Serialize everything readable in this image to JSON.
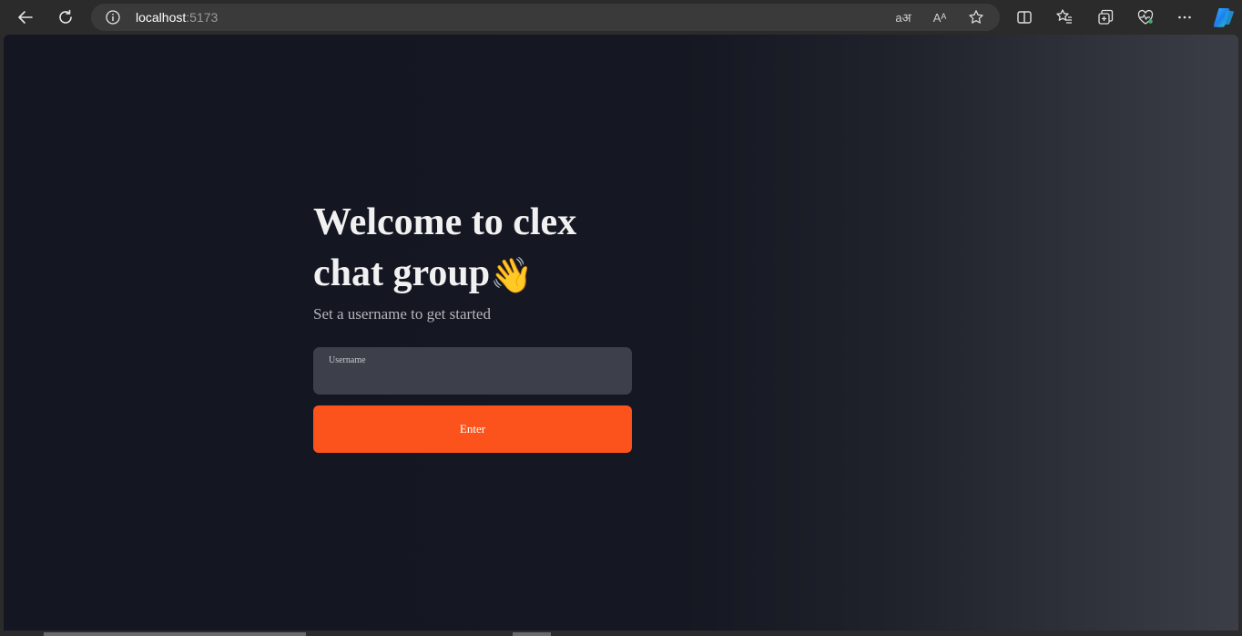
{
  "browser": {
    "url_host": "localhost",
    "url_port": ":5173",
    "icons": {
      "back": "back-arrow-icon",
      "refresh": "refresh-icon",
      "info": "info-icon",
      "translate": "translate-icon",
      "read_aloud": "read-aloud-icon",
      "favorite": "star-icon",
      "split_screen": "split-screen-icon",
      "favorites": "favorites-icon",
      "collections": "collections-icon",
      "health": "browser-essentials-icon",
      "more": "more-icon",
      "copilot": "copilot-icon"
    },
    "read_aloud_label": "Aᴬ",
    "translate_label": "aअ"
  },
  "page": {
    "headline_line1": "Welcome to clex",
    "headline_line2": "chat group",
    "wave_emoji": "👋",
    "subtitle": "Set a username to get started",
    "username_label": "Username",
    "username_value": "",
    "enter_button": "Enter",
    "colors": {
      "accent": "#fb531b",
      "background_dark": "#141621",
      "input_bg": "#3d3f4a"
    }
  }
}
